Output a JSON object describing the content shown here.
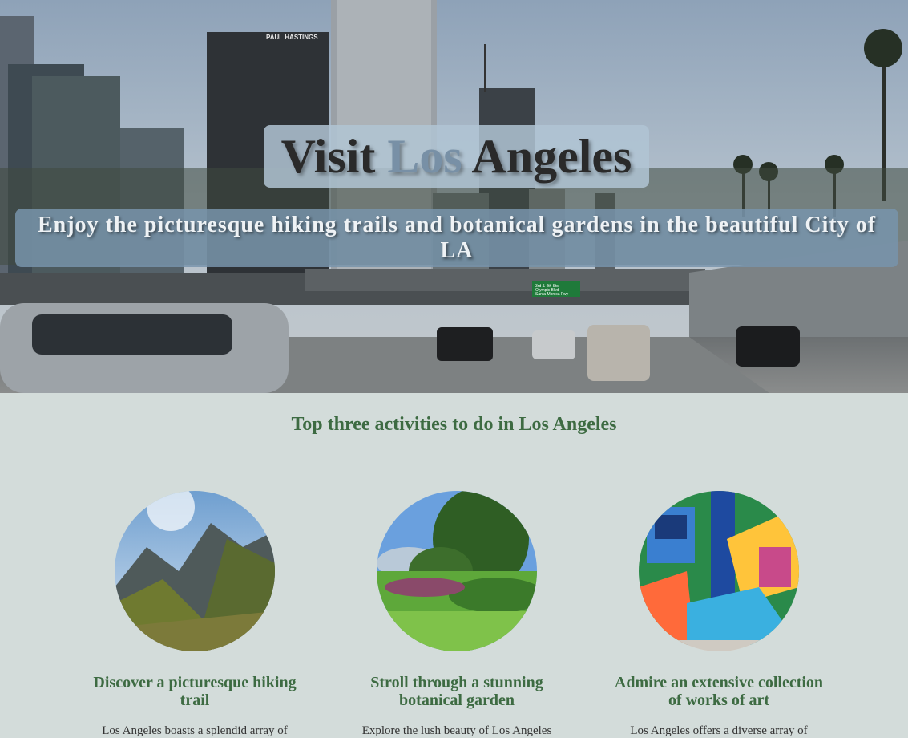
{
  "hero": {
    "title_prefix": "Visit ",
    "title_accent": "Los",
    "title_suffix": " Angeles",
    "subtitle": "Enjoy the picturesque hiking trails and botanical gardens in the beautiful City of LA",
    "building_sign": "PAUL HASTINGS",
    "highway_sign_lines": [
      "3rd & 4th Sts",
      "Olympic Blvd",
      "Santa Monica Fwy"
    ]
  },
  "section": {
    "title": "Top three activities to do in Los Angeles"
  },
  "activities": [
    {
      "heading": "Discover a picturesque hiking trail",
      "text": "Los Angeles boasts a splendid array of",
      "image_icon": "mountain-trail-photo"
    },
    {
      "heading": "Stroll through a stunning botanical garden",
      "text": "Explore the lush beauty of Los Angeles",
      "image_icon": "botanical-garden-photo"
    },
    {
      "heading": "Admire an extensive collection of works of art",
      "text": "Los Angeles offers a diverse array of",
      "image_icon": "art-mural-photo"
    }
  ],
  "colors": {
    "page_background": "#d3dcda",
    "heading_green": "#3d6b42",
    "title_accent": "#7890a6"
  }
}
